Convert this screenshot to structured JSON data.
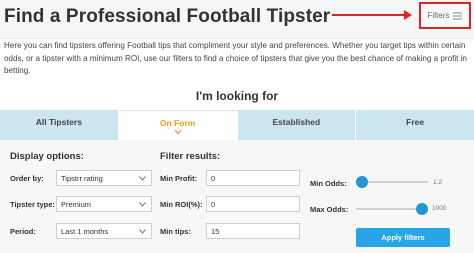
{
  "header": {
    "title": "Find a Professional Football Tipster",
    "filters_label": "Filters"
  },
  "intro": "Here you can find tipsters offering Football tips that compliment your style and preferences. Whether you target tips within certain odds, or a tipster with a minimum ROI, use our filters to find a choice of tipsters that give you the best chance of making a profit in betting.",
  "looking_for": "I'm looking for",
  "tabs": [
    {
      "label": "All Tipsters"
    },
    {
      "label": "On Form"
    },
    {
      "label": "Established"
    },
    {
      "label": "Free"
    }
  ],
  "display": {
    "heading": "Display options:",
    "order_label": "Order by:",
    "order_value": "Tipstrr rating",
    "type_label": "Tipster type:",
    "type_value": "Premium",
    "period_label": "Period:",
    "period_value": "Last 1 months"
  },
  "filter": {
    "heading": "Filter results:",
    "min_profit_label": "Min Profit:",
    "min_profit_value": "0",
    "min_roi_label": "Min ROI(%):",
    "min_roi_value": "0",
    "min_tips_label": "Min tips:",
    "min_tips_value": "15",
    "min_odds_label": "Min Odds:",
    "min_odds_value": "1.2",
    "max_odds_label": "Max Odds:",
    "max_odds_value": "1000",
    "apply_label": "Apply filters"
  },
  "colors": {
    "accent": "#f0a019",
    "tab_bg": "#cbe6ef",
    "button": "#26a6e6",
    "slider": "#2196d3",
    "highlight": "#e02424"
  }
}
